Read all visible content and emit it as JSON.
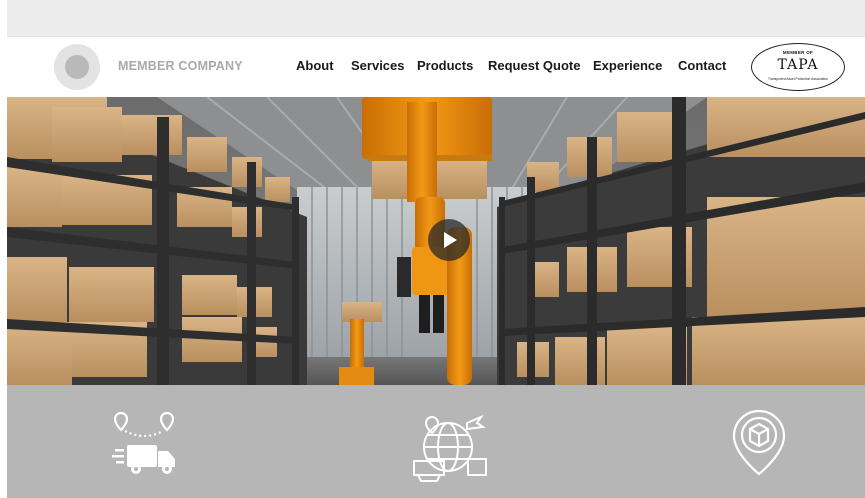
{
  "brand": {
    "name": "MEMBER COMPANY"
  },
  "nav": {
    "items": [
      {
        "label": "About",
        "name": "nav-about"
      },
      {
        "label": "Services",
        "name": "nav-services"
      },
      {
        "label": "Products",
        "name": "nav-products"
      },
      {
        "label": "Request Quote",
        "name": "nav-request-quote"
      },
      {
        "label": "Experience",
        "name": "nav-experience"
      },
      {
        "label": "Contact",
        "name": "nav-contact"
      }
    ]
  },
  "badge": {
    "member_text": "MEMBER OF",
    "mark_text": "TAPA",
    "tagline": "Transported Asset Protection Association"
  },
  "hero": {
    "play_icon": "play-icon"
  },
  "services": {
    "icons": [
      "delivery-truck-route-icon",
      "global-logistics-icon",
      "package-location-pin-icon"
    ]
  },
  "colors": {
    "nav_text": "#1a1a1a",
    "brand_text": "#a9a9a9",
    "services_bg": "#b6b6b6",
    "robot_orange": "#f0900e"
  }
}
